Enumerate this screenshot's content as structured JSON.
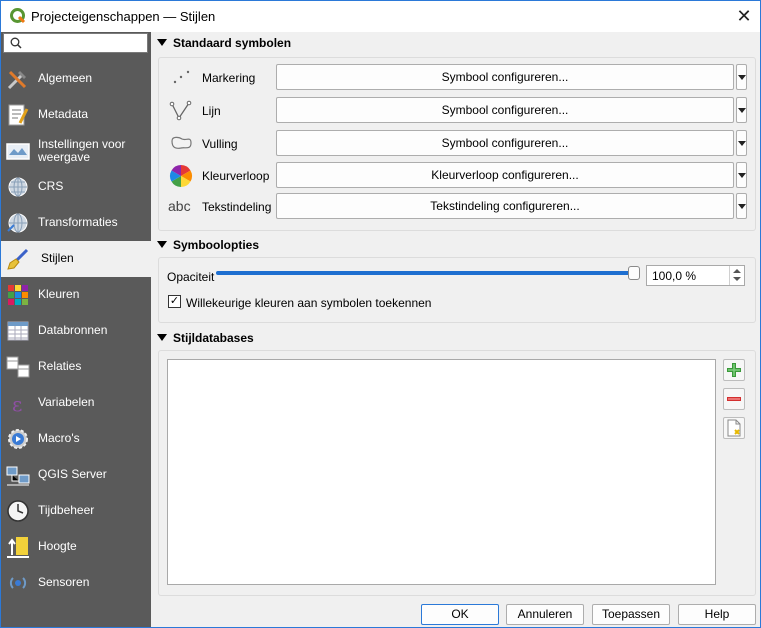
{
  "window": {
    "title": "Projecteigenschappen — Stijlen",
    "close_glyph": "✕"
  },
  "sidebar": {
    "search_placeholder": "",
    "items": [
      {
        "label": "Algemeen",
        "icon": "tools-icon"
      },
      {
        "label": "Metadata",
        "icon": "metadata-icon"
      },
      {
        "label": "Instellingen voor weergave",
        "icon": "map-settings-icon"
      },
      {
        "label": "CRS",
        "icon": "globe-icon"
      },
      {
        "label": "Transformaties",
        "icon": "globe-transform-icon"
      },
      {
        "label": "Stijlen",
        "icon": "paintbrush-icon",
        "active": true
      },
      {
        "label": "Kleuren",
        "icon": "color-grid-icon"
      },
      {
        "label": "Databronnen",
        "icon": "table-icon"
      },
      {
        "label": "Relaties",
        "icon": "relations-icon"
      },
      {
        "label": "Variabelen",
        "icon": "epsilon-icon"
      },
      {
        "label": "Macro's",
        "icon": "macro-gear-icon"
      },
      {
        "label": "QGIS Server",
        "icon": "server-icon"
      },
      {
        "label": "Tijdbeheer",
        "icon": "clock-icon"
      },
      {
        "label": "Hoogte",
        "icon": "elevation-icon"
      },
      {
        "label": "Sensoren",
        "icon": "sensor-icon"
      }
    ]
  },
  "standaard": {
    "heading": "Standaard symbolen",
    "rows": [
      {
        "label": "Markering",
        "button": "Symbool configureren..."
      },
      {
        "label": "Lijn",
        "button": "Symbool configureren..."
      },
      {
        "label": "Vulling",
        "button": "Symbool configureren..."
      },
      {
        "label": "Kleurverloop",
        "button": "Kleurverloop configureren..."
      },
      {
        "label": "Tekstindeling",
        "button": "Tekstindeling configureren...",
        "icon_text": "abc"
      }
    ]
  },
  "symboolopties": {
    "heading": "Symboolopties",
    "opacity_label": "Opaciteit",
    "opacity_value": "100,0 %",
    "opacity_fraction": 1.0,
    "random_colors_label": "Willekeurige kleuren aan symbolen toekennen",
    "random_colors_checked": true,
    "check_glyph": "✓"
  },
  "stijldatabases": {
    "heading": "Stijldatabases"
  },
  "buttons": {
    "ok": "OK",
    "cancel": "Annuleren",
    "apply": "Toepassen",
    "help": "Help"
  },
  "colors": {
    "accent": "#1e6fd0",
    "sidebar": "#5a5a5a",
    "window_border": "#2b79d8"
  }
}
